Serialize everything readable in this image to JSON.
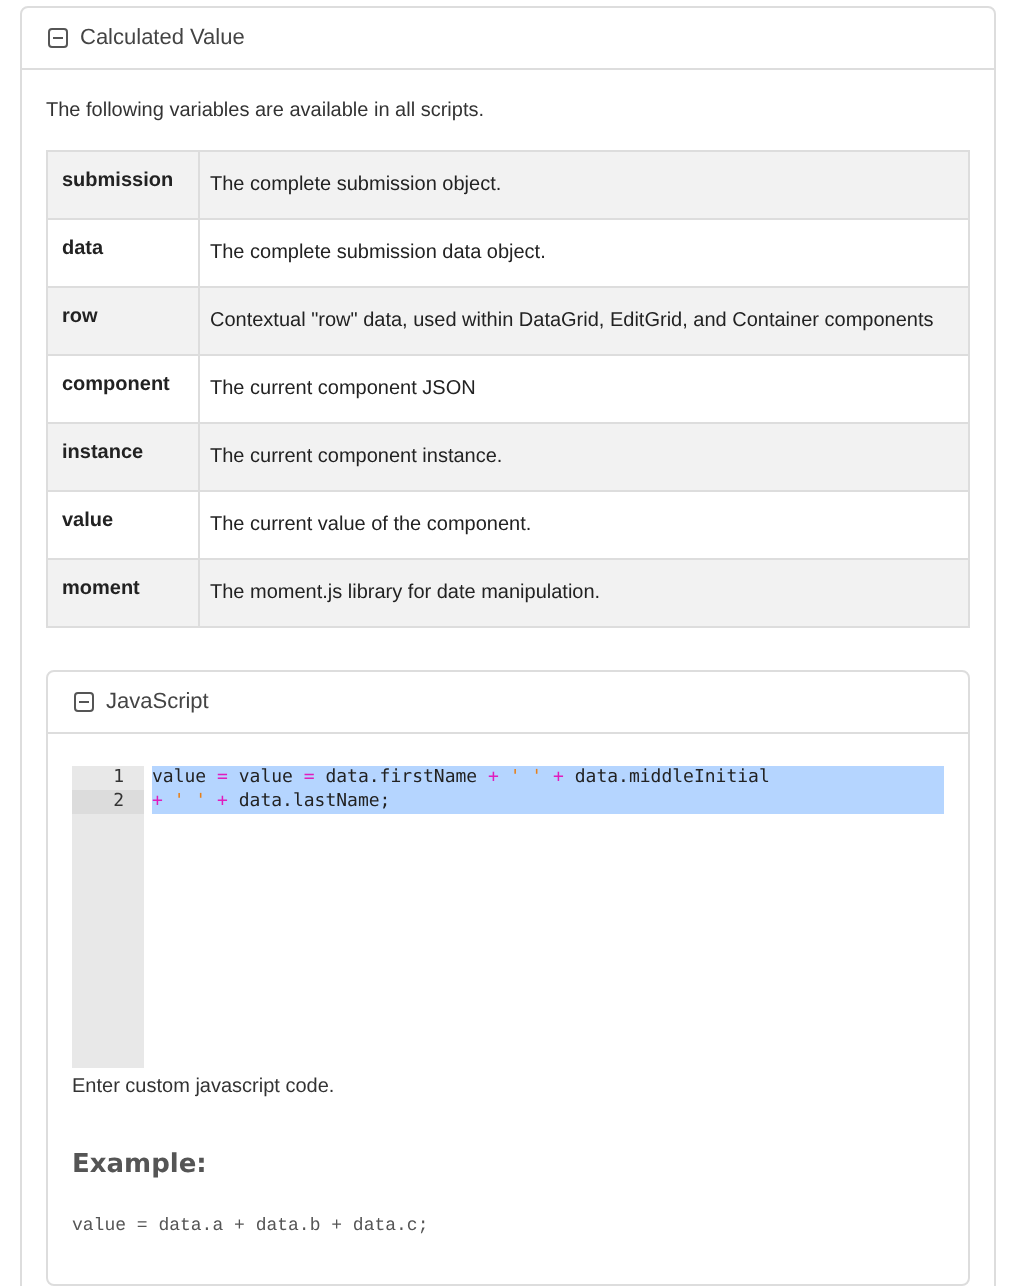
{
  "panel": {
    "title": "Calculated Value",
    "expanded": true
  },
  "intro": "The following variables are available in all scripts.",
  "variables": [
    {
      "name": "submission",
      "description": "The complete submission object."
    },
    {
      "name": "data",
      "description": "The complete submission data object."
    },
    {
      "name": "row",
      "description": "Contextual \"row\" data, used within DataGrid, EditGrid, and Container components"
    },
    {
      "name": "component",
      "description": "The current component JSON"
    },
    {
      "name": "instance",
      "description": "The current component instance."
    },
    {
      "name": "value",
      "description": "The current value of the component."
    },
    {
      "name": "moment",
      "description": "The moment.js library for date manipulation."
    }
  ],
  "editor_panel": {
    "title": "JavaScript",
    "expanded": true,
    "lines": [
      {
        "number": "1",
        "active": false,
        "selected": true,
        "tokens": [
          {
            "kind": "plain",
            "text": "value "
          },
          {
            "kind": "op",
            "text": "="
          },
          {
            "kind": "plain",
            "text": " value "
          },
          {
            "kind": "op",
            "text": "="
          },
          {
            "kind": "plain",
            "text": " data.firstName "
          },
          {
            "kind": "op",
            "text": "+"
          },
          {
            "kind": "string",
            "text": " ' ' "
          },
          {
            "kind": "op",
            "text": "+"
          },
          {
            "kind": "plain",
            "text": " data.middleInitial"
          }
        ]
      },
      {
        "number": "2",
        "active": true,
        "selected": true,
        "tokens": [
          {
            "kind": "op",
            "text": "+"
          },
          {
            "kind": "string",
            "text": " ' ' "
          },
          {
            "kind": "op",
            "text": "+"
          },
          {
            "kind": "plain",
            "text": " data.lastName;"
          }
        ]
      }
    ],
    "help": "Enter custom javascript code.",
    "example_heading": "Example:",
    "example_code": "value = data.a + data.b + data.c;"
  }
}
